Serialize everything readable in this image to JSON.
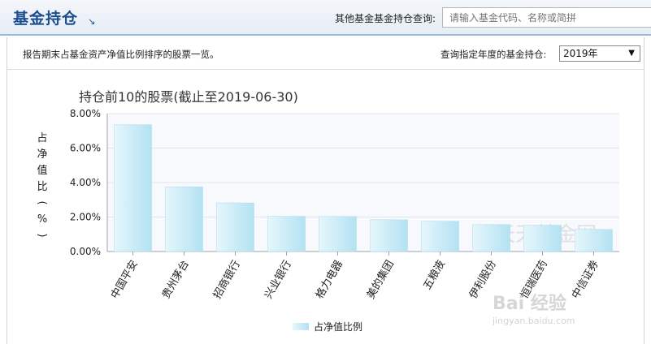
{
  "header": {
    "title": "基金持仓",
    "title_arrow": "↘",
    "search_label": "其他基金基金持仓查询:",
    "search_placeholder": "请输入基金代码、名称或简拼"
  },
  "subbar": {
    "description": "报告期末占基金资产净值比例排序的股票一览。",
    "year_label": "查询指定年度的基金持仓:",
    "year_value": "2019年",
    "year_arrow": "▼"
  },
  "watermarks": {
    "site": "天天基金网",
    "baidu": "Bai 经验",
    "baidu_url": "jingyan.baidu.com"
  },
  "colors": {
    "bar_fill_light": "#e6f6fc",
    "bar_fill_dark": "#b3e2f2",
    "plot_bg": "#f8f9fc",
    "grid": "#e1e6ee",
    "axis": "#99a3b0",
    "title": "#333333"
  },
  "chart_data": {
    "type": "bar",
    "title": "持仓前10的股票(截止至2019-06-30)",
    "ylabel": "占净值比(%)",
    "ylim": [
      0,
      8
    ],
    "yticks": [
      "0.00%",
      "2.00%",
      "4.00%",
      "6.00%",
      "8.00%"
    ],
    "categories": [
      "中国平安",
      "贵州茅台",
      "招商银行",
      "兴业银行",
      "格力电器",
      "美的集团",
      "五粮液",
      "伊利股份",
      "恒瑞医药",
      "中信证券"
    ],
    "series": [
      {
        "name": "占净值比例",
        "values": [
          7.35,
          3.75,
          2.82,
          2.04,
          2.03,
          1.84,
          1.75,
          1.56,
          1.52,
          1.28
        ]
      }
    ],
    "grid": true,
    "legend": "bottom-center"
  }
}
